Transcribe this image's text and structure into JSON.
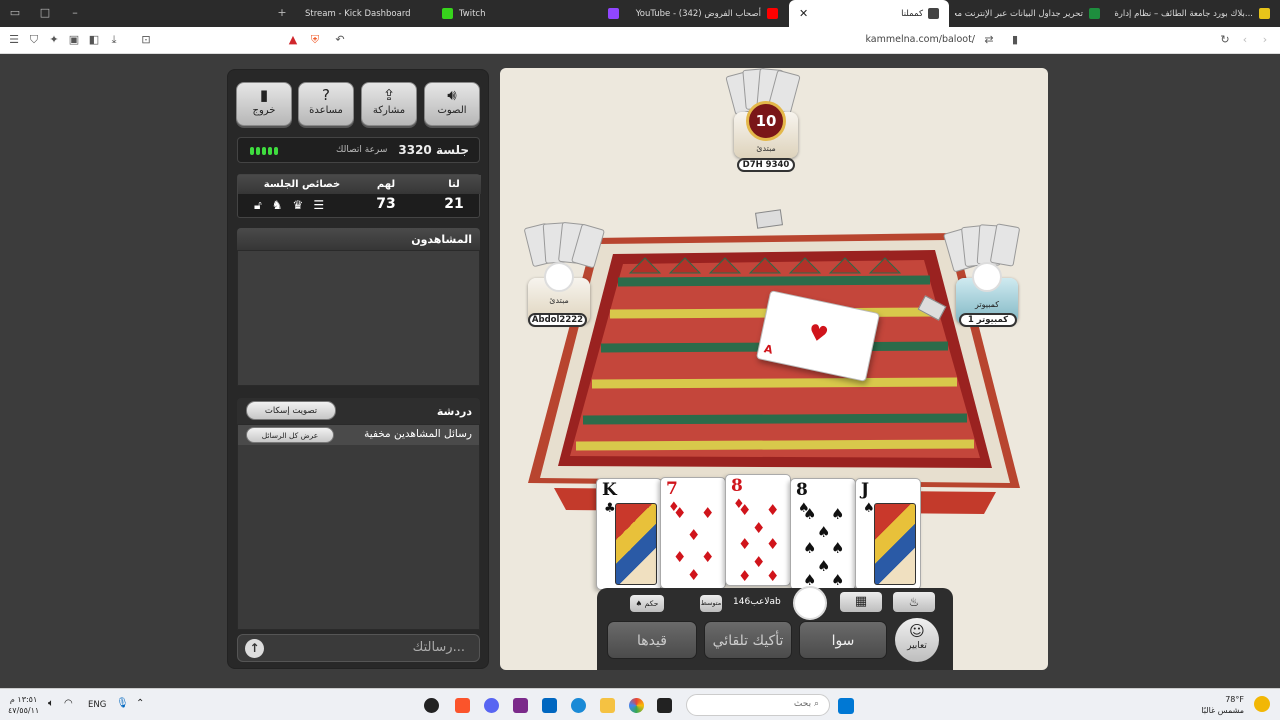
{
  "browser": {
    "tabs": [
      {
        "label": "Stream - Kick Dashboard"
      },
      {
        "label": "Twitch"
      },
      {
        "label": "YouTube - (342) أصحاب الفروض"
      },
      {
        "label": "كمملنا"
      },
      {
        "label": "تحرير جداول البيانات عبر الإنترنت مجاناً"
      },
      {
        "label": "بلاك بورد جامعة الطائف – نظام إدارة ال..."
      }
    ],
    "address": "kammelna.com/baloot/",
    "icons": [
      "menu-icon",
      "shield-icon",
      "puzzle-icon",
      "tab-icon",
      "sidebar-icon",
      "download-icon",
      "screenshot-icon",
      "brave-rewards-icon",
      "brave-shield-icon",
      "back-icon",
      "reload-icon",
      "bookmark-icon"
    ]
  },
  "toolbar": {
    "sound_label": "الصوت",
    "share_label": "مشاركة",
    "help_label": "مساعدة",
    "exit_label": "خروج"
  },
  "session": {
    "title": "جلسة 3320",
    "connection_label": "سرعة اتصالك"
  },
  "score": {
    "us_label": "لنا",
    "them_label": "لهم",
    "props_label": "خصائص الجلسة",
    "us_value": "21",
    "them_value": "73"
  },
  "spectators": {
    "header": "المشاهدون"
  },
  "chat": {
    "header": "دردشة",
    "mute_vote_label": "تصويت إسكات",
    "hidden_msg": "رسائل المشاهدين مخفية",
    "show_all_label": "عرض كل الرسائل",
    "input_placeholder": "رسالتك..."
  },
  "players": {
    "top": {
      "name": "D7H 9340",
      "rank": "مبتدئ",
      "timer": "10"
    },
    "left": {
      "name": "Abdol2222",
      "rank": "مبتدئ"
    },
    "right": {
      "name": "كمبيوتر 1",
      "rank": "كمبيوتر"
    },
    "me": {
      "name": "لاعب146ab"
    }
  },
  "table": {
    "played_card": {
      "rank": "A",
      "suit": "♥"
    }
  },
  "hand": [
    {
      "rank": "K",
      "suit": "♣",
      "color": "#111111"
    },
    {
      "rank": "7",
      "suit": "♦",
      "color": "#d0141b"
    },
    {
      "rank": "8",
      "suit": "♦",
      "color": "#d0141b"
    },
    {
      "rank": "8",
      "suit": "♠",
      "color": "#111111"
    },
    {
      "rank": "J",
      "suit": "♠",
      "color": "#111111"
    }
  ],
  "controls": {
    "hokm_label": "حكم",
    "mid_label": "متوسط",
    "expressions_label": "تعابير",
    "sawa_label": "سوا",
    "auto_label": "تأكيك تلقائي",
    "record_label": "قيدها"
  },
  "taskbar": {
    "weather_temp": "78°F",
    "weather_desc": "مشمس غالبًا",
    "lang": "ENG",
    "time": "١٣:٥١ م",
    "date": "٤٧/٥٥/١١",
    "search_placeholder": "بحث"
  }
}
